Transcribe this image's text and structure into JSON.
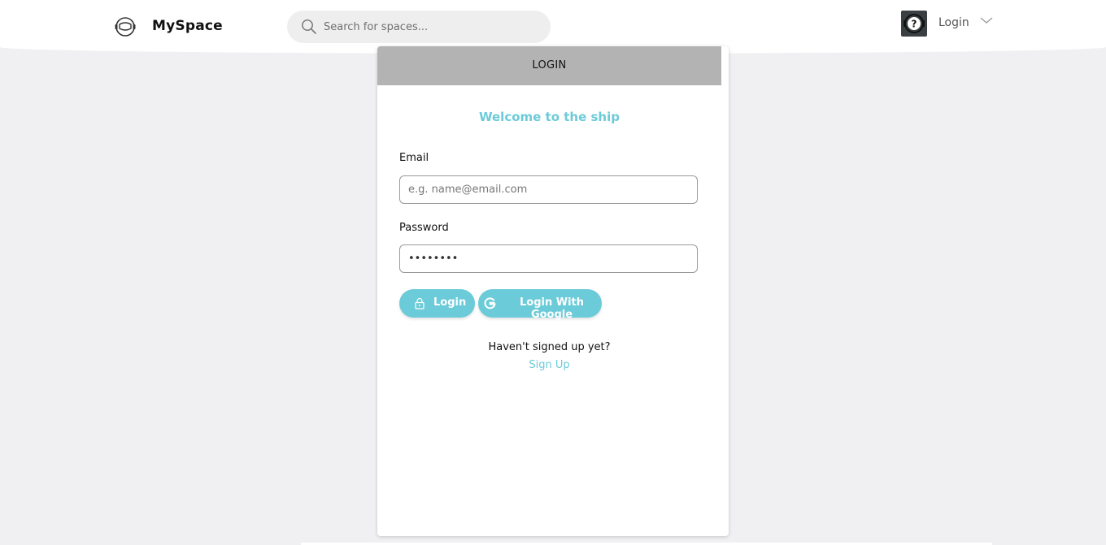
{
  "header": {
    "brand_name": "MySpace",
    "brand_icon": "astronaut-helmet-icon",
    "search": {
      "placeholder": "Search for spaces...",
      "value": "",
      "icon": "search-icon"
    },
    "user": {
      "avatar_icon": "avatar-question-icon",
      "login_label": "Login",
      "dropdown_icon": "chevron-down-icon"
    }
  },
  "card": {
    "tab_label": "LOGIN",
    "welcome": "Welcome to the ship",
    "email": {
      "label": "Email",
      "placeholder": "e.g. name@email.com",
      "value": ""
    },
    "password": {
      "label": "Password",
      "value": "••••••••"
    },
    "buttons": {
      "login": "Login",
      "google": "Login With Google"
    },
    "signup_prompt": "Haven't signed up yet?",
    "signup_link": "Sign Up"
  },
  "colors": {
    "accent": "#6ccbd8",
    "tab_header": "#b3b3b3",
    "background": "#f0f0f2"
  }
}
